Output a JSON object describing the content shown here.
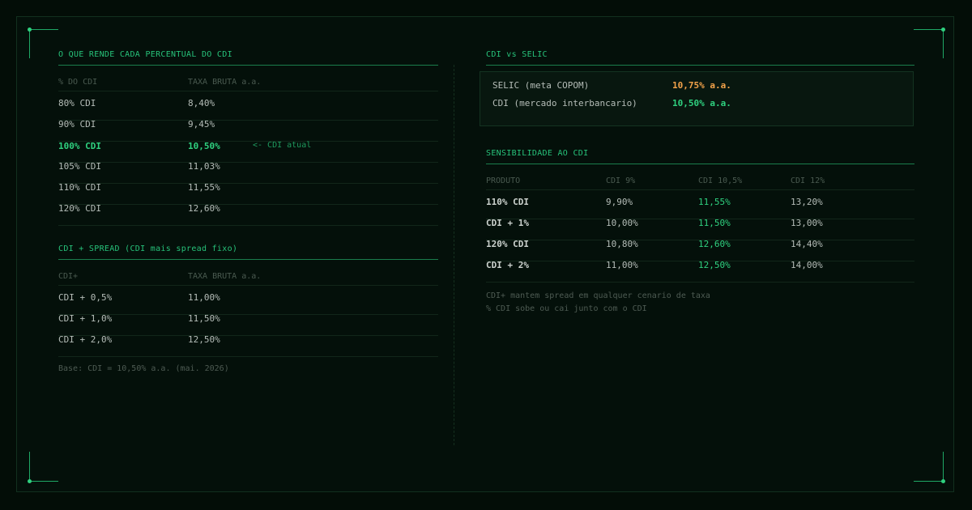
{
  "left": {
    "cdi_pct": {
      "title": "O QUE RENDE CADA PERCENTUAL DO CDI",
      "col_pct": "% DO CDI",
      "col_rate": "TAXA BRUTA a.a.",
      "rows": [
        {
          "label": "80%  CDI",
          "rate": "8,40%"
        },
        {
          "label": "90%  CDI",
          "rate": "9,45%"
        },
        {
          "label": "100% CDI",
          "rate": "10,50%",
          "note": "<- CDI atual"
        },
        {
          "label": "105% CDI",
          "rate": "11,03%"
        },
        {
          "label": "110% CDI",
          "rate": "11,55%"
        },
        {
          "label": "120% CDI",
          "rate": "12,60%"
        }
      ]
    },
    "spread": {
      "title": "CDI + SPREAD (CDI mais spread fixo)",
      "col_label": "CDI+",
      "col_rate": "TAXA BRUTA a.a.",
      "rows": [
        {
          "label": "CDI + 0,5%",
          "rate": "11,00%"
        },
        {
          "label": "CDI + 1,0%",
          "rate": "11,50%"
        },
        {
          "label": "CDI + 2,0%",
          "rate": "12,50%"
        }
      ]
    },
    "footnote": "Base: CDI = 10,50% a.a. (mai. 2026)"
  },
  "right": {
    "selic": {
      "title": "CDI vs SELIC",
      "rows": [
        {
          "label": "SELIC (meta COPOM)",
          "value": "10,75% a.a."
        },
        {
          "label": "CDI (mercado interbancario)",
          "value": "10,50% a.a."
        }
      ]
    },
    "sens": {
      "title": "SENSIBILIDADE AO CDI",
      "headers": [
        "PRODUTO",
        "CDI 9%",
        "CDI 10,5%",
        "CDI 12%"
      ],
      "rows": [
        {
          "prod": "110% CDI",
          "v1": "9,90%",
          "v2": "11,55%",
          "v3": "13,20%"
        },
        {
          "prod": "CDI + 1%",
          "v1": "10,00%",
          "v2": "11,50%",
          "v3": "13,00%"
        },
        {
          "prod": "120% CDI",
          "v1": "10,80%",
          "v2": "12,60%",
          "v3": "14,40%"
        },
        {
          "prod": "CDI + 2%",
          "v1": "11,00%",
          "v2": "12,50%",
          "v3": "14,00%"
        }
      ],
      "notes": [
        "CDI+ mantem spread em qualquer cenario de taxa",
        "% CDI sobe ou cai junto com o CDI"
      ]
    }
  },
  "colors": {
    "accent": "#2fd07f",
    "orange": "#f2a24a",
    "background": "#030d07"
  }
}
